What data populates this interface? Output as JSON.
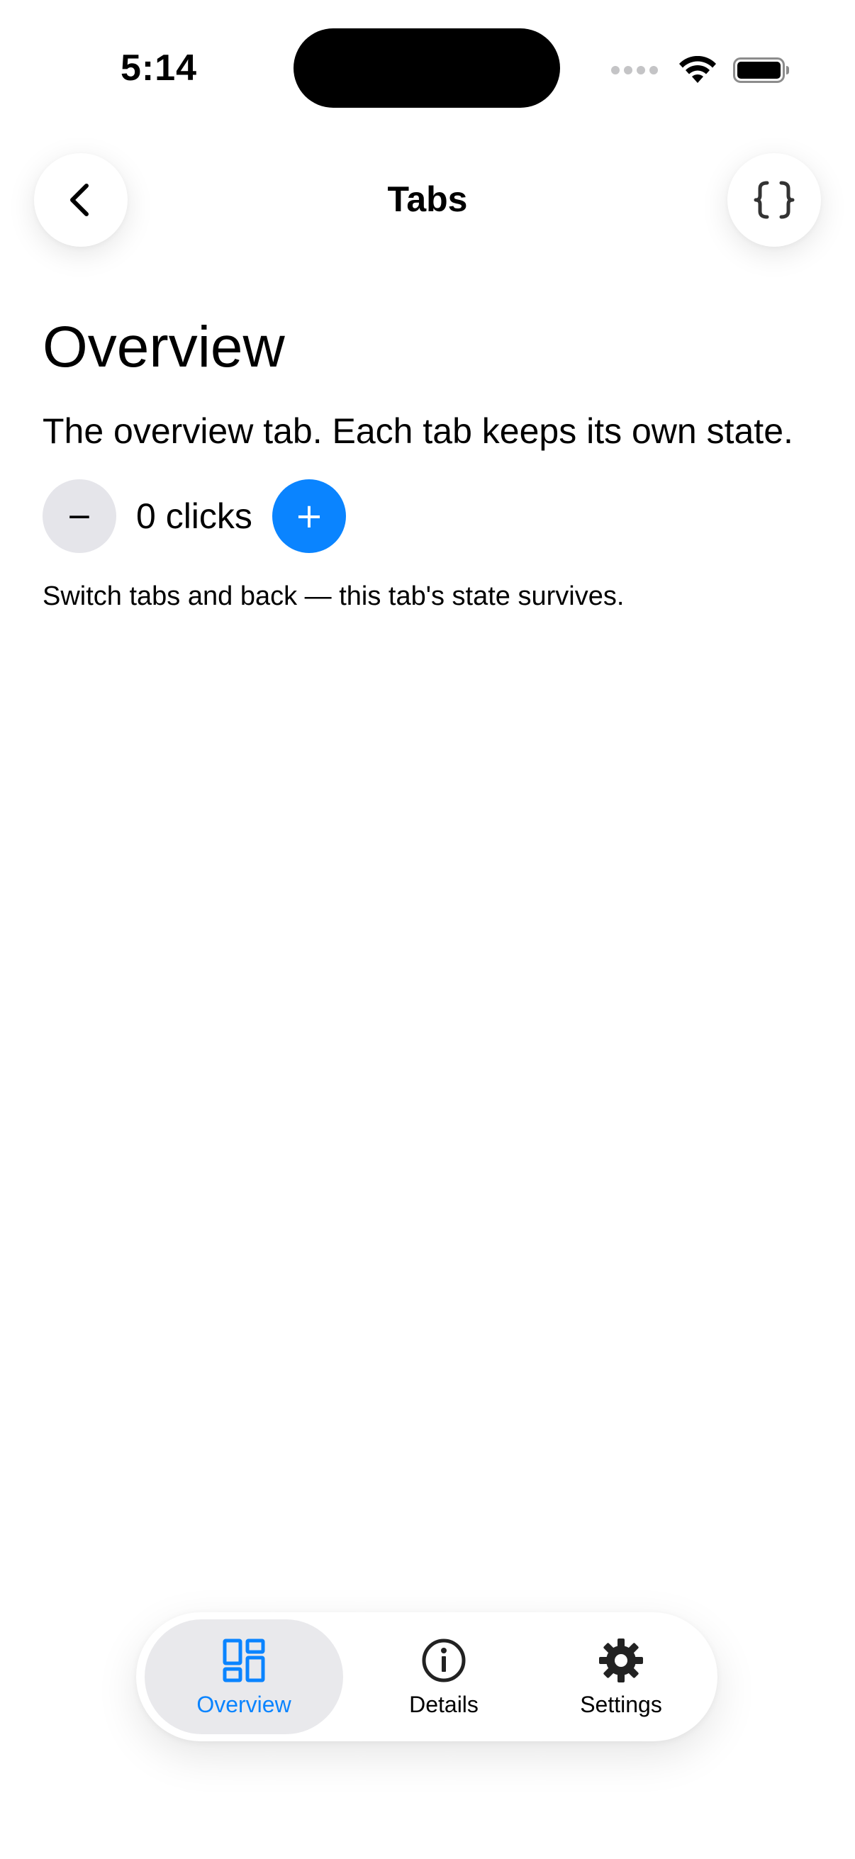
{
  "status_bar": {
    "time": "5:14"
  },
  "nav": {
    "title": "Tabs",
    "back_icon": "chevron-left-icon",
    "code_icon": "curly-braces-icon"
  },
  "content": {
    "heading": "Overview",
    "description": "The overview tab. Each tab keeps its own state.",
    "counter": {
      "decrement_label": "−",
      "value_text": "0 clicks",
      "increment_label": "+"
    },
    "hint": "Switch tabs and back — this tab's state survives."
  },
  "tab_bar": {
    "tabs": [
      {
        "label": "Overview",
        "icon": "dashboard-icon",
        "selected": true
      },
      {
        "label": "Details",
        "icon": "info-circle-icon",
        "selected": false
      },
      {
        "label": "Settings",
        "icon": "gear-icon",
        "selected": false
      }
    ]
  },
  "colors": {
    "accent": "#0a84ff",
    "secondary_button": "#e5e5ea",
    "selected_tab_bg": "#e9e9ec"
  }
}
